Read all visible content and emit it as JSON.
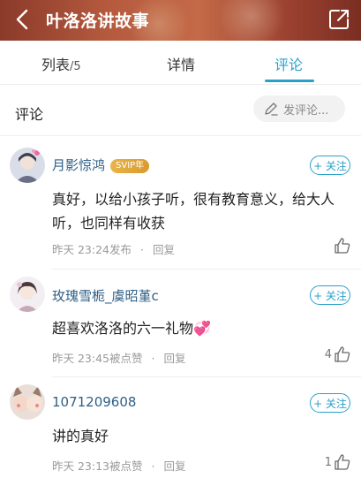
{
  "header": {
    "title": "叶洛洛讲故事"
  },
  "tabs": [
    {
      "label": "列表",
      "count": "/5"
    },
    {
      "label": "详情"
    },
    {
      "label": "评论",
      "active": true
    }
  ],
  "comments_section": {
    "title": "评论",
    "compose_label": "发评论..."
  },
  "follow_label": "+ 关注",
  "comments": [
    {
      "username": "月影惊鸿",
      "badge": "SVIP年",
      "text": "真好，以给小孩子听，很有教育意义，给大人听，也同样有收获",
      "time": "昨天 23:24发布",
      "reply": "回复",
      "likes": ""
    },
    {
      "username": "玫瑰雪栀_虞昭堇c",
      "text": "超喜欢洛洛的六一礼物💞",
      "time": "昨天 23:45被点赞",
      "reply": "回复",
      "likes": "4"
    },
    {
      "username": "1071209608",
      "text": "讲的真好",
      "time": "昨天 23:13被点赞",
      "reply": "回复",
      "likes": "1"
    }
  ],
  "colors": {
    "accent": "#2aa0c8",
    "username": "#2e5f86",
    "svip": "#e0a63a"
  }
}
